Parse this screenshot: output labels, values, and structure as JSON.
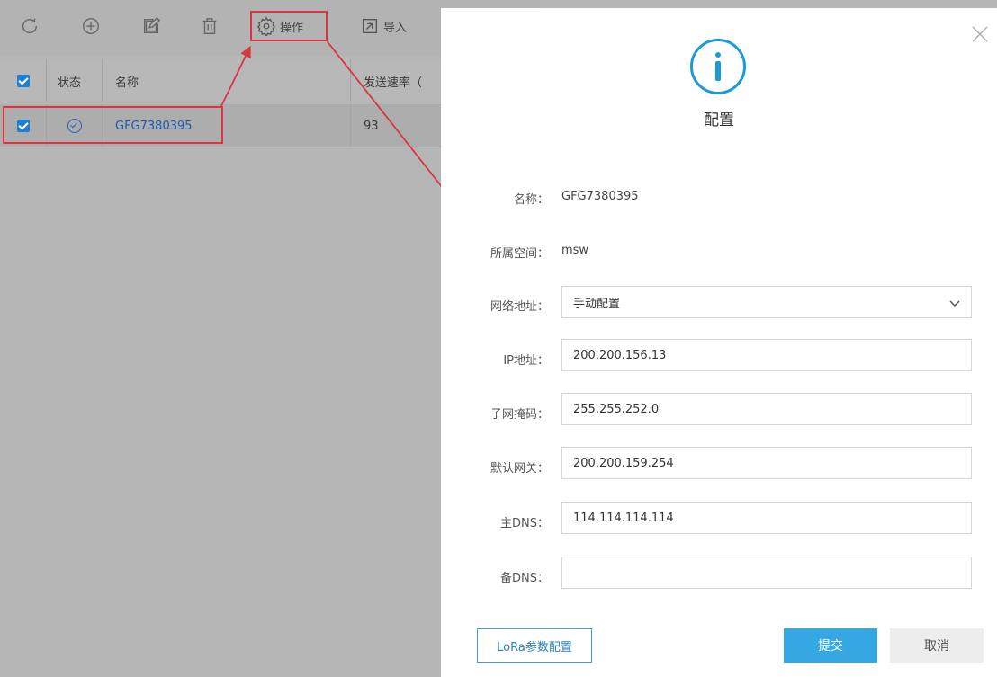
{
  "toolbar": {
    "buttons": [
      {
        "icon": "refresh-icon",
        "label": ""
      },
      {
        "icon": "add-icon",
        "label": ""
      },
      {
        "icon": "edit-icon",
        "label": ""
      },
      {
        "icon": "delete-icon",
        "label": ""
      },
      {
        "icon": "gear-icon",
        "label": "操作"
      },
      {
        "icon": "import-icon",
        "label": "导入"
      }
    ]
  },
  "grid": {
    "headers": [
      "状态",
      "名称",
      "发送速率（"
    ],
    "rows": [
      {
        "checked": true,
        "status": "check-circle-icon",
        "name": "GFG7380395",
        "rate": "93"
      }
    ]
  },
  "dialog": {
    "title": "配置",
    "fields": {
      "name": {
        "label": "名称：",
        "value": "GFG7380395"
      },
      "space": {
        "label": "所属空间：",
        "value": "msw"
      },
      "network": {
        "label": "网络地址：",
        "value": "手动配置"
      },
      "ip": {
        "label": "IP地址：",
        "value": "200.200.156.13"
      },
      "mask": {
        "label": "子网掩码：",
        "value": "255.255.252.0"
      },
      "gateway": {
        "label": "默认网关：",
        "value": "200.200.159.254"
      },
      "dns1": {
        "label": "主DNS：",
        "value": "114.114.114.114"
      },
      "dns2": {
        "label": "备DNS：",
        "value": ""
      }
    },
    "buttons": {
      "lora": "LoRa参数配置",
      "submit": "提交",
      "cancel": "取消"
    }
  },
  "colors": {
    "accent": "#35a7e3",
    "info_icon": "#1a9bd8",
    "annotation": "#d9363e",
    "link": "#1f5aa8"
  }
}
